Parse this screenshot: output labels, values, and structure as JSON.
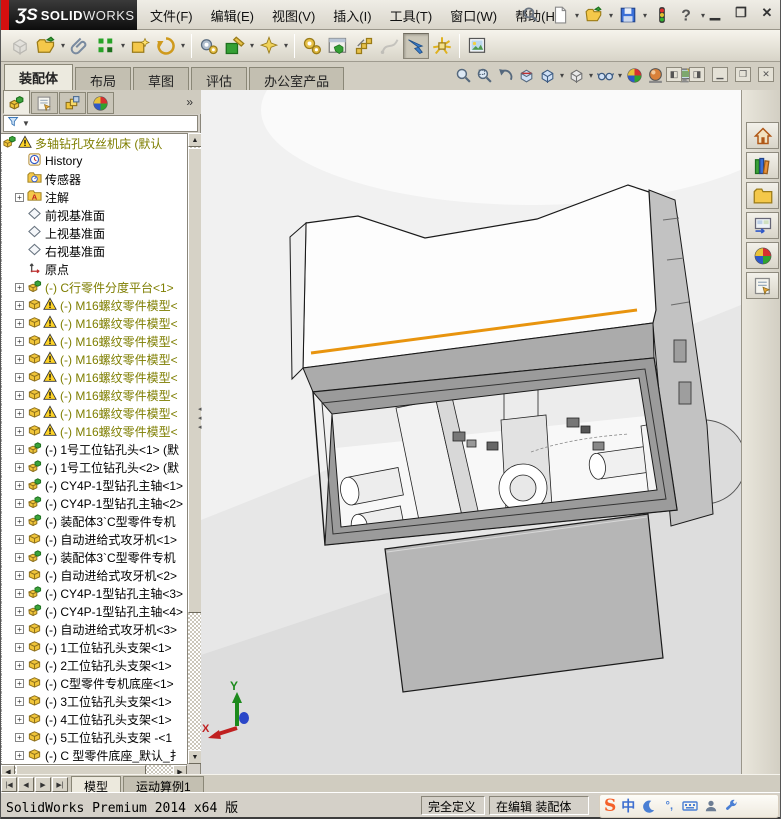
{
  "title_bar": {
    "logo_prefix": "ƷS",
    "logo_bold": "SOLID",
    "logo_light": "WORKS",
    "menus": [
      {
        "label": "文件(F)"
      },
      {
        "label": "编辑(E)"
      },
      {
        "label": "视图(V)"
      },
      {
        "label": "插入(I)"
      },
      {
        "label": "工具(T)"
      },
      {
        "label": "窗口(W)"
      },
      {
        "label": "帮助(H)"
      }
    ],
    "quick_icons": [
      {
        "name": "new-document-icon",
        "type": "newdoc",
        "dropdown": true
      },
      {
        "name": "open-document-icon",
        "type": "folderopen",
        "dropdown": true
      },
      {
        "name": "save-icon",
        "type": "save",
        "dropdown": true
      },
      {
        "name": "traffic-light-icon",
        "type": "traffic",
        "dropdown": false
      },
      {
        "name": "help-icon",
        "type": "help",
        "dropdown": true
      }
    ],
    "window_controls": [
      {
        "name": "minimize-button",
        "glyph": "▁"
      },
      {
        "name": "restore-button",
        "glyph": "❐"
      },
      {
        "name": "close-button",
        "glyph": "✕"
      }
    ]
  },
  "assembly_toolbar": {
    "icons": [
      {
        "name": "insert-components",
        "type": "cubegray",
        "disabled": true
      },
      {
        "name": "open-part",
        "type": "folderopen",
        "dropdown": true
      },
      {
        "name": "mate",
        "type": "paperclip"
      },
      {
        "name": "linear-component-pattern",
        "type": "patterngreen",
        "dropdown": true
      },
      {
        "name": "smart-fasteners",
        "type": "boxstar"
      },
      {
        "name": "rotate-component",
        "type": "rotategold",
        "dropdown": true
      },
      {
        "sep": true
      },
      {
        "name": "assembly-features",
        "type": "gearsblue"
      },
      {
        "name": "reference-geometry",
        "type": "machinehammer",
        "dropdown": true
      },
      {
        "name": "sketch",
        "type": "sparkle",
        "dropdown": true
      },
      {
        "sep": true
      },
      {
        "name": "new-motion-study",
        "type": "gearsgold"
      },
      {
        "name": "bill-of-materials",
        "type": "bomwindow"
      },
      {
        "name": "exploded-view",
        "type": "explodegold"
      },
      {
        "name": "explode-line-sketch",
        "type": "sketchgray",
        "disabled": true
      },
      {
        "name": "instant3d",
        "type": "arrowblue",
        "pressed": true
      },
      {
        "name": "large-design-review",
        "type": "radiategold"
      },
      {
        "sep": true
      },
      {
        "name": "take-snapshot",
        "type": "photoframe"
      }
    ]
  },
  "command_manager": {
    "tabs": [
      {
        "label": "装配体",
        "active": true
      },
      {
        "label": "布局",
        "active": false
      },
      {
        "label": "草图",
        "active": false
      },
      {
        "label": "评估",
        "active": false
      },
      {
        "label": "办公室产品",
        "active": false
      }
    ]
  },
  "view_toolbar": [
    {
      "name": "zoom-to-fit",
      "type": "magnifier"
    },
    {
      "name": "zoom-to-area",
      "type": "magarea"
    },
    {
      "name": "previous-view",
      "type": "prevview"
    },
    {
      "name": "section-view",
      "type": "sectionview"
    },
    {
      "name": "view-orientation",
      "type": "viewcube",
      "dropdown": true
    },
    {
      "name": "display-style",
      "type": "stylecube",
      "dropdown": true
    },
    {
      "name": "hide-show-items",
      "type": "glasses",
      "dropdown": true
    },
    {
      "name": "edit-appearance",
      "type": "sphere"
    },
    {
      "name": "apply-scene",
      "type": "spherescene",
      "dropdown": true
    },
    {
      "name": "view-settings",
      "type": "monitor",
      "dropdown": true
    }
  ],
  "document_controls": [
    {
      "name": "pane-left-toggle",
      "glyph": "◧"
    },
    {
      "name": "pane-right-toggle",
      "glyph": "◨"
    },
    {
      "name": "doc-minimize",
      "glyph": "▁"
    },
    {
      "name": "doc-restore",
      "glyph": "❐"
    },
    {
      "name": "doc-close",
      "glyph": "✕"
    }
  ],
  "feature_panel": {
    "tabs": [
      {
        "name": "featuremanager-tab",
        "type": "asmroot",
        "active": true
      },
      {
        "name": "propertymanager-tab",
        "type": "propform",
        "active": false
      },
      {
        "name": "configurationmanager-tab",
        "type": "configstack",
        "active": false
      },
      {
        "name": "displaymanager-tab",
        "type": "sphere",
        "active": false
      }
    ],
    "overflow_label": "»",
    "tree": [
      {
        "label": "多轴钻孔攻丝机床 (默认",
        "icon": "asmroot",
        "warning": true,
        "olive": true,
        "indent": 0,
        "expander": false
      },
      {
        "label": "History",
        "icon": "history",
        "warning": false,
        "olive": false,
        "indent": 1,
        "expander": false
      },
      {
        "label": "传感器",
        "icon": "sensors",
        "warning": false,
        "olive": false,
        "indent": 1,
        "expander": false
      },
      {
        "label": "注解",
        "icon": "annotations",
        "warning": false,
        "olive": false,
        "indent": 1,
        "expander": true
      },
      {
        "label": "前视基准面",
        "icon": "plane",
        "warning": false,
        "olive": false,
        "indent": 1,
        "expander": false
      },
      {
        "label": "上视基准面",
        "icon": "plane",
        "warning": false,
        "olive": false,
        "indent": 1,
        "expander": false
      },
      {
        "label": "右视基准面",
        "icon": "plane",
        "warning": false,
        "olive": false,
        "indent": 1,
        "expander": false
      },
      {
        "label": "原点",
        "icon": "origin",
        "warning": false,
        "olive": false,
        "indent": 1,
        "expander": false
      },
      {
        "label": "(-) C行零件分度平台<1>",
        "icon": "subasm",
        "warning": false,
        "olive": true,
        "indent": 1,
        "expander": true
      },
      {
        "label": "(-) M16螺纹零件模型<",
        "icon": "partyellow",
        "warning": true,
        "olive": true,
        "indent": 1,
        "expander": true
      },
      {
        "label": "(-) M16螺纹零件模型<",
        "icon": "partyellow",
        "warning": true,
        "olive": true,
        "indent": 1,
        "expander": true
      },
      {
        "label": "(-) M16螺纹零件模型<",
        "icon": "partyellow",
        "warning": true,
        "olive": true,
        "indent": 1,
        "expander": true
      },
      {
        "label": "(-) M16螺纹零件模型<",
        "icon": "partyellow",
        "warning": true,
        "olive": true,
        "indent": 1,
        "expander": true
      },
      {
        "label": "(-) M16螺纹零件模型<",
        "icon": "partyellow",
        "warning": true,
        "olive": true,
        "indent": 1,
        "expander": true
      },
      {
        "label": "(-) M16螺纹零件模型<",
        "icon": "partyellow",
        "warning": true,
        "olive": true,
        "indent": 1,
        "expander": true
      },
      {
        "label": "(-) M16螺纹零件模型<",
        "icon": "partyellow",
        "warning": true,
        "olive": true,
        "indent": 1,
        "expander": true
      },
      {
        "label": "(-) M16螺纹零件模型<",
        "icon": "partyellow",
        "warning": true,
        "olive": true,
        "indent": 1,
        "expander": true
      },
      {
        "label": "(-) 1号工位钻孔头<1> (默",
        "icon": "subasm",
        "warning": false,
        "olive": false,
        "indent": 1,
        "expander": true
      },
      {
        "label": "(-) 1号工位钻孔头<2> (默",
        "icon": "subasm",
        "warning": false,
        "olive": false,
        "indent": 1,
        "expander": true
      },
      {
        "label": "(-) CY4P-1型钻孔主轴<1>",
        "icon": "subasm",
        "warning": false,
        "olive": false,
        "indent": 1,
        "expander": true
      },
      {
        "label": "(-) CY4P-1型钻孔主轴<2>",
        "icon": "subasm",
        "warning": false,
        "olive": false,
        "indent": 1,
        "expander": true
      },
      {
        "label": "(-) 装配体3`C型零件专机",
        "icon": "subasm",
        "warning": false,
        "olive": false,
        "indent": 1,
        "expander": true
      },
      {
        "label": "(-) 自动进给式攻牙机<1>",
        "icon": "partyellow",
        "warning": false,
        "olive": false,
        "indent": 1,
        "expander": true
      },
      {
        "label": "(-) 装配体3`C型零件专机",
        "icon": "subasm",
        "warning": false,
        "olive": false,
        "indent": 1,
        "expander": true
      },
      {
        "label": "(-) 自动进给式攻牙机<2>",
        "icon": "partyellow",
        "warning": false,
        "olive": false,
        "indent": 1,
        "expander": true
      },
      {
        "label": "(-) CY4P-1型钻孔主轴<3>",
        "icon": "subasm",
        "warning": false,
        "olive": false,
        "indent": 1,
        "expander": true
      },
      {
        "label": "(-) CY4P-1型钻孔主轴<4>",
        "icon": "subasm",
        "warning": false,
        "olive": false,
        "indent": 1,
        "expander": true
      },
      {
        "label": "(-) 自动进给式攻牙机<3>",
        "icon": "partyellow",
        "warning": false,
        "olive": false,
        "indent": 1,
        "expander": true
      },
      {
        "label": "(-) 1工位钻孔头支架<1>",
        "icon": "partyellow",
        "warning": false,
        "olive": false,
        "indent": 1,
        "expander": true
      },
      {
        "label": "(-) 2工位钻孔头支架<1>",
        "icon": "partyellow",
        "warning": false,
        "olive": false,
        "indent": 1,
        "expander": true
      },
      {
        "label": "(-) C型零件专机底座<1>",
        "icon": "partyellow",
        "warning": false,
        "olive": false,
        "indent": 1,
        "expander": true
      },
      {
        "label": "(-) 3工位钻孔头支架<1>",
        "icon": "partyellow",
        "warning": false,
        "olive": false,
        "indent": 1,
        "expander": true
      },
      {
        "label": "(-) 4工位钻孔头支架<1>",
        "icon": "partyellow",
        "warning": false,
        "olive": false,
        "indent": 1,
        "expander": true
      },
      {
        "label": "(-) 5工位钻孔头支架 -<1",
        "icon": "partyellow",
        "warning": false,
        "olive": false,
        "indent": 1,
        "expander": true
      },
      {
        "label": "(-) C 型零件底座_默认_扌",
        "icon": "partyellow",
        "warning": false,
        "olive": false,
        "indent": 1,
        "expander": true
      }
    ]
  },
  "viewport": {
    "triad": {
      "x_label": "X",
      "y_label": "Y"
    },
    "accent_line_color": "#e8940e"
  },
  "task_pane": [
    {
      "name": "solidworks-resources",
      "type": "home"
    },
    {
      "name": "design-library",
      "type": "books"
    },
    {
      "name": "file-explorer",
      "type": "folderyellow"
    },
    {
      "name": "view-palette",
      "type": "palette"
    },
    {
      "name": "appearances-scenes",
      "type": "sphere"
    },
    {
      "name": "custom-properties",
      "type": "propform"
    }
  ],
  "bottom_bar": {
    "tabs": [
      {
        "label": "模型",
        "active": true
      },
      {
        "label": "运动算例1",
        "active": false
      }
    ]
  },
  "status_bar": {
    "product": "SolidWorks Premium 2014 x64 版",
    "define_state": "完全定义",
    "edit_state": "在编辑 装配体",
    "ime": {
      "logo": "S",
      "mode": "中"
    }
  }
}
